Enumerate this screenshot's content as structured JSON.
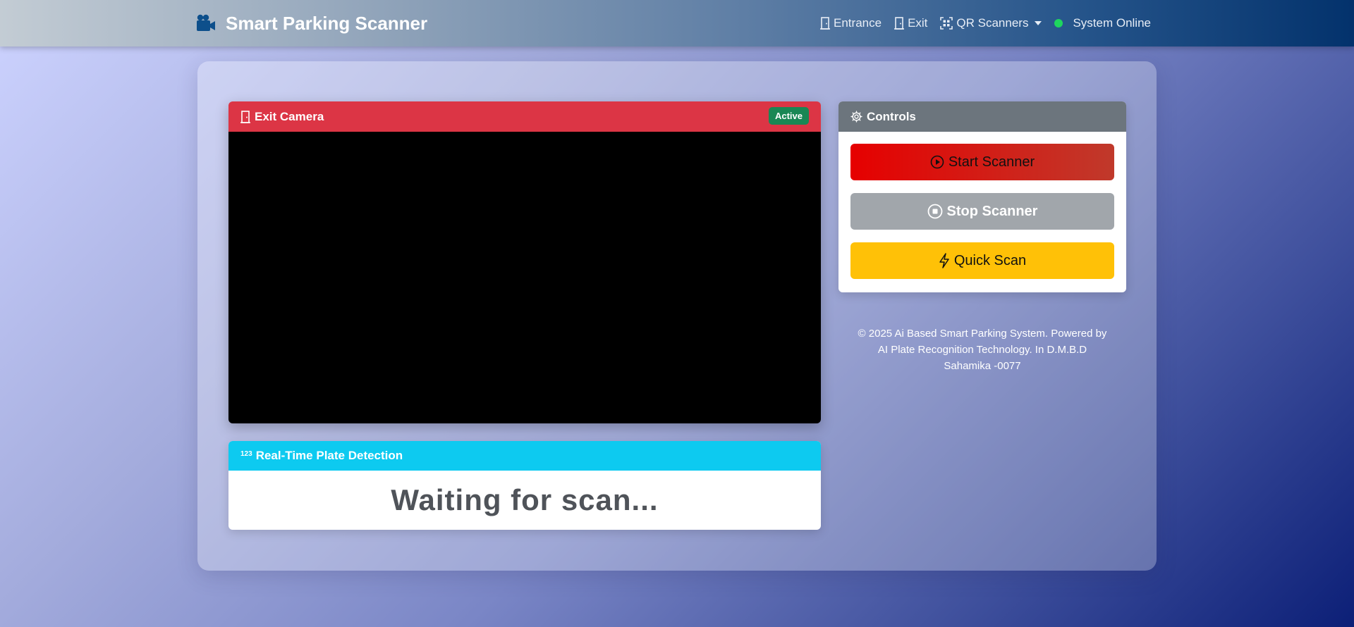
{
  "navbar": {
    "brand": "Smart Parking Scanner",
    "brand_icon": "video-camera-icon",
    "links": {
      "entrance": "Entrance",
      "exit": "Exit",
      "qr_scanners": "QR Scanners"
    },
    "status": "System Online",
    "status_color": "#1ed65e"
  },
  "camera": {
    "title": "Exit Camera",
    "badge": "Active",
    "header_color": "#dc3545",
    "badge_color": "#198754"
  },
  "plate": {
    "icon_text": "123",
    "title": "Real-Time Plate Detection",
    "value": "Waiting for scan...",
    "header_color": "#0dcaf0"
  },
  "controls": {
    "title": "Controls",
    "start_label": "Start Scanner",
    "stop_label": "Stop Scanner",
    "quick_label": "Quick Scan"
  },
  "footer": {
    "text": "© 2025 Ai Based Smart Parking System. Powered by AI Plate Recognition Technology. In D.M.B.D Sahamika -0077"
  }
}
